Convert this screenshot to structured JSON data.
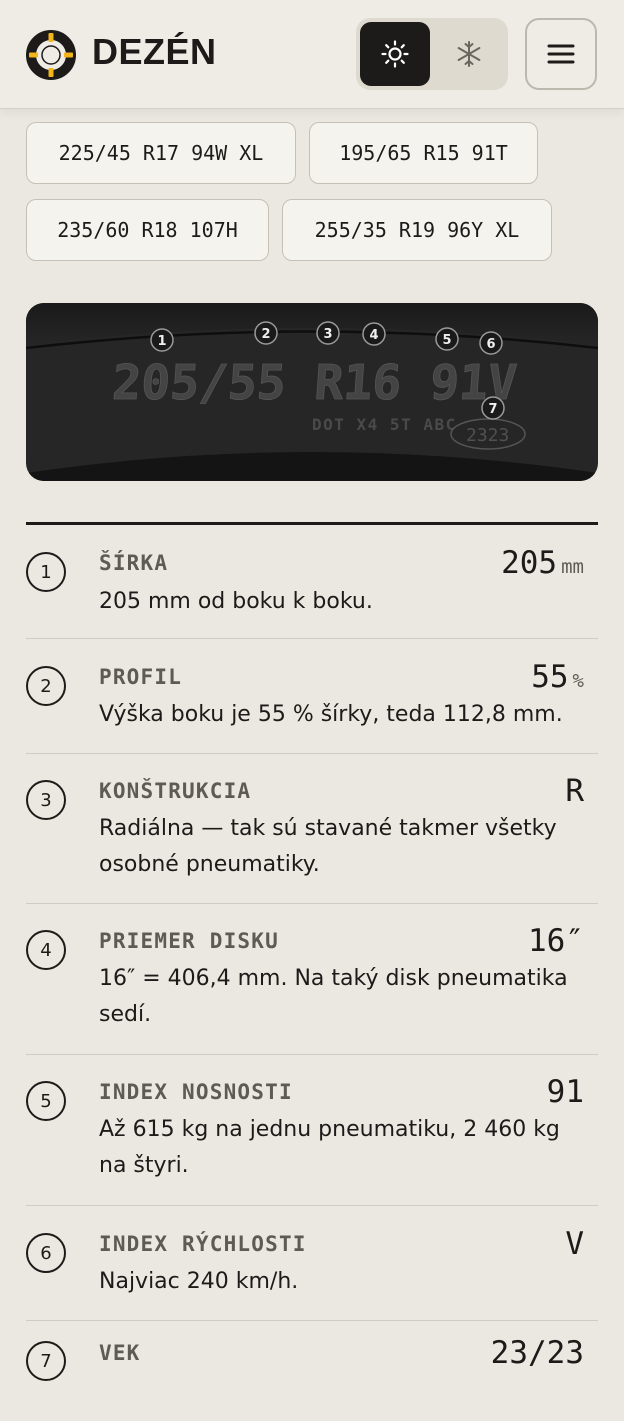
{
  "brand": {
    "name": "DEZÉN"
  },
  "season_toggle": {
    "summer_icon": "sun-icon",
    "winter_icon": "snowflake-icon",
    "active": "summer"
  },
  "menu": {
    "icon": "hamburger-menu-icon"
  },
  "size_chips": [
    "225/45 R17 94W XL",
    "195/65 R15 91T",
    "235/60 R18 107H",
    "255/35 R19 96Y XL"
  ],
  "tire": {
    "size_text": "205/55 R16 91V",
    "dot_text": "DOT X4 5T ABC",
    "dot_date": "2323",
    "markers": [
      "1",
      "2",
      "3",
      "4",
      "5",
      "6",
      "7"
    ]
  },
  "specs": [
    {
      "num": "1",
      "label": "ŠÍRKA",
      "value": "205",
      "unit": "mm",
      "desc": "205 mm od boku k boku."
    },
    {
      "num": "2",
      "label": "PROFIL",
      "value": "55",
      "unit": "%",
      "desc": "Výška boku je 55 % šírky, teda 112,8 mm."
    },
    {
      "num": "3",
      "label": "KONŠTRUKCIA",
      "value": "R",
      "unit": "",
      "desc": "Radiálna — tak sú stavané takmer všetky osobné pneumatiky."
    },
    {
      "num": "4",
      "label": "PRIEMER DISKU",
      "value": "16″",
      "unit": "",
      "desc": "16″ = 406,4 mm. Na taký disk pneumatika sedí."
    },
    {
      "num": "5",
      "label": "INDEX NOSNOSTI",
      "value": "91",
      "unit": "",
      "desc": "Až 615 kg na jednu pneumatiku, 2 460 kg na štyri."
    },
    {
      "num": "6",
      "label": "INDEX RÝCHLOSTI",
      "value": "V",
      "unit": "",
      "desc": "Najviac 240 km/h."
    },
    {
      "num": "7",
      "label": "VEK",
      "value": "23/23",
      "unit": "",
      "desc": ""
    }
  ]
}
